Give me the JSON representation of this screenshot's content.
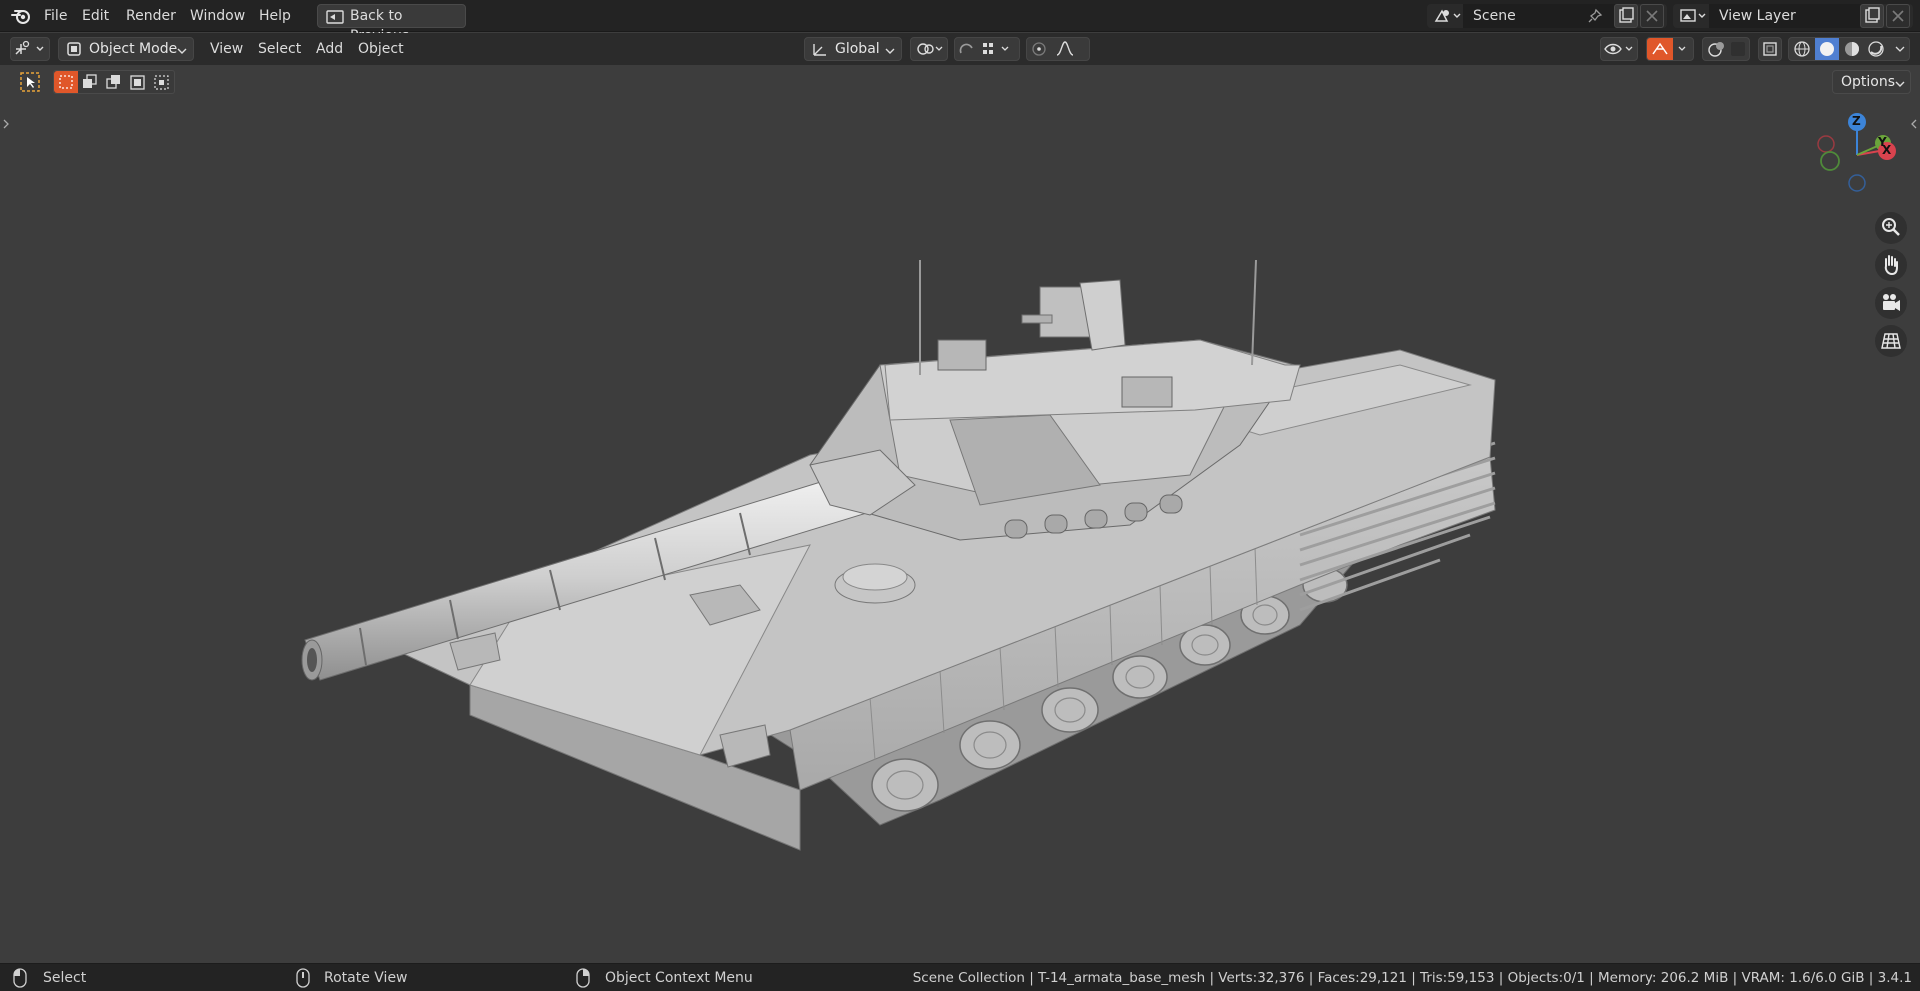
{
  "menu": {
    "items": [
      "File",
      "Edit",
      "Render",
      "Window",
      "Help"
    ],
    "back_button": "Back to Previous"
  },
  "scene": {
    "label": "Scene"
  },
  "view_layer": {
    "label": "View Layer"
  },
  "header": {
    "mode": "Object Mode",
    "menus": [
      "View",
      "Select",
      "Add",
      "Object"
    ],
    "orientation": "Global"
  },
  "toolbar": {
    "options_label": "Options"
  },
  "gizmo": {
    "z": "Z",
    "y": "Y",
    "x": "X"
  },
  "status": {
    "select": "Select",
    "rotate": "Rotate View",
    "context": "Object Context Menu",
    "info": "Scene Collection | T-14_armata_base_mesh | Verts:32,376 | Faces:29,121 | Tris:59,153 | Objects:0/1 | Memory: 206.2 MiB | VRAM: 1.6/6.0 GiB | 3.4.1"
  },
  "colors": {
    "accent_orange": "#e0572a",
    "axis_x": "#d9434e",
    "axis_y": "#6ba53b",
    "axis_z": "#3c84d8",
    "active_shading": "#4f7fd1"
  },
  "icons": [
    "blender-logo-icon",
    "back-icon",
    "scene-icon",
    "pin-icon",
    "copy-icon",
    "close-icon",
    "view-layer-icon",
    "editor-type-icon",
    "object-mode-icon",
    "orientation-icon",
    "pivot-icon",
    "snap-icon",
    "proportional-icon",
    "select-box-icon",
    "visibility-icon",
    "gizmo-icon",
    "overlay-icon",
    "xray-icon",
    "shading-wireframe-icon",
    "shading-solid-icon",
    "shading-material-icon",
    "shading-rendered-icon",
    "zoom-icon",
    "hand-icon",
    "camera-icon",
    "grid-icon",
    "mouse-left-icon",
    "mouse-middle-icon",
    "mouse-right-icon"
  ]
}
